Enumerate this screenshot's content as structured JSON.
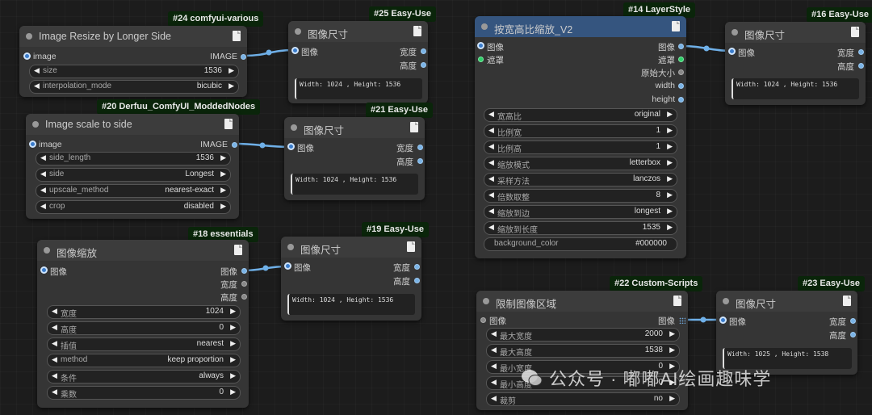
{
  "nodes": {
    "n24": {
      "badge": "#24 comfyui-various",
      "title": "Image Resize by Longer Side",
      "in_label": "image",
      "out_label": "IMAGE",
      "widgets": [
        {
          "name": "size",
          "value": "1536"
        },
        {
          "name": "interpolation_mode",
          "value": "bicubic"
        }
      ]
    },
    "n25": {
      "badge": "#25 Easy-Use",
      "title": "图像尺寸",
      "in_label": "图像",
      "out1": "宽度",
      "out2": "高度",
      "output": "Width: 1024 , Height: 1536"
    },
    "n20": {
      "badge": "#20 Derfuu_ComfyUI_ModdedNodes",
      "title": "Image scale to side",
      "in_label": "image",
      "out_label": "IMAGE",
      "widgets": [
        {
          "name": "side_length",
          "value": "1536"
        },
        {
          "name": "side",
          "value": "Longest"
        },
        {
          "name": "upscale_method",
          "value": "nearest-exact"
        },
        {
          "name": "crop",
          "value": "disabled"
        }
      ]
    },
    "n21": {
      "badge": "#21 Easy-Use",
      "title": "图像尺寸",
      "in_label": "图像",
      "out1": "宽度",
      "out2": "高度",
      "output": "Width: 1024 , Height: 1536"
    },
    "n18": {
      "badge": "#18 essentials",
      "title": "图像缩放",
      "in_label": "图像",
      "out1": "图像",
      "out2": "宽度",
      "out3": "高度",
      "widgets": [
        {
          "name": "宽度",
          "value": "1024"
        },
        {
          "name": "高度",
          "value": "0"
        },
        {
          "name": "插值",
          "value": "nearest"
        },
        {
          "name": "method",
          "value": "keep proportion"
        },
        {
          "name": "条件",
          "value": "always"
        },
        {
          "name": "乘数",
          "value": "0"
        }
      ]
    },
    "n19": {
      "badge": "#19 Easy-Use",
      "title": "图像尺寸",
      "in_label": "图像",
      "out1": "宽度",
      "out2": "高度",
      "output": "Width: 1024 , Height: 1536"
    },
    "n14": {
      "badge": "#14 LayerStyle",
      "title": "按宽高比缩放_V2",
      "in1": "图像",
      "in2": "遮罩",
      "out1": "图像",
      "out2": "遮罩",
      "out3": "原始大小",
      "out4": "width",
      "out5": "height",
      "widgets": [
        {
          "name": "宽高比",
          "value": "original"
        },
        {
          "name": "比例宽",
          "value": "1"
        },
        {
          "name": "比例高",
          "value": "1"
        },
        {
          "name": "缩放模式",
          "value": "letterbox"
        },
        {
          "name": "采样方法",
          "value": "lanczos"
        },
        {
          "name": "倍数取整",
          "value": "8"
        },
        {
          "name": "缩放到边",
          "value": "longest"
        },
        {
          "name": "缩放到长度",
          "value": "1535"
        }
      ],
      "plain_widget": {
        "name": "background_color",
        "value": "#000000"
      }
    },
    "n16": {
      "badge": "#16 Easy-Use",
      "title": "图像尺寸",
      "in_label": "图像",
      "out1": "宽度",
      "out2": "高度",
      "output": "Width: 1024 , Height: 1536"
    },
    "n22": {
      "badge": "#22 Custom-Scripts",
      "title": "限制图像区域",
      "in_label": "图像",
      "out_label": "图像",
      "widgets": [
        {
          "name": "最大宽度",
          "value": "2000"
        },
        {
          "name": "最大高度",
          "value": "1538"
        },
        {
          "name": "最小宽度",
          "value": "0"
        },
        {
          "name": "最小高度",
          "value": "0"
        },
        {
          "name": "裁剪",
          "value": "no"
        }
      ]
    },
    "n23": {
      "badge": "#23 Easy-Use",
      "title": "图像尺寸",
      "in_label": "图像",
      "out1": "宽度",
      "out2": "高度",
      "output": "Width: 1025 , Height: 1538"
    }
  },
  "watermark": "公众号 · 嘟嘟AI绘画趣味学",
  "colors": {
    "link": "#6fb0e8",
    "badge_bg": "#0a250a",
    "node_bg": "#353535",
    "header_blue": "#35557f"
  }
}
